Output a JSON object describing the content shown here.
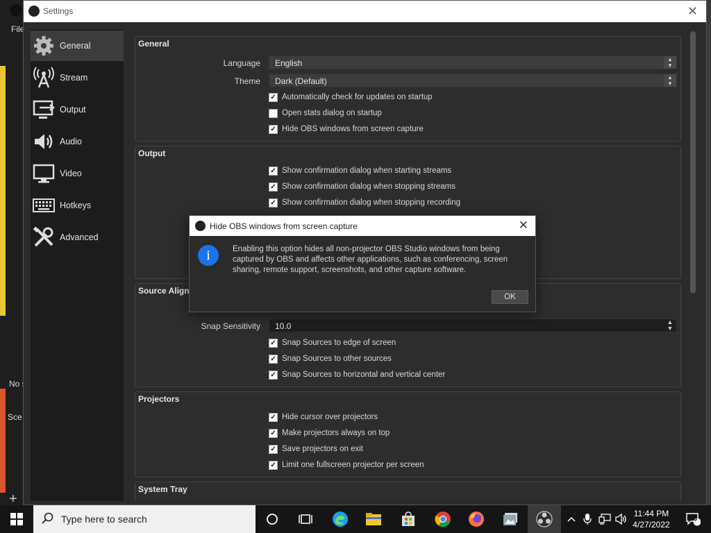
{
  "background": {
    "menu_file": "File",
    "no_source_text": "No s",
    "scenes_text": "Sce",
    "add_icon": "plus-icon"
  },
  "window": {
    "title": "Settings",
    "close": "✕"
  },
  "sidebar": {
    "items": [
      {
        "label": "General",
        "icon": "gear-icon"
      },
      {
        "label": "Stream",
        "icon": "broadcast-tower-icon"
      },
      {
        "label": "Output",
        "icon": "output-monitor-icon"
      },
      {
        "label": "Audio",
        "icon": "speaker-icon"
      },
      {
        "label": "Video",
        "icon": "monitor-icon"
      },
      {
        "label": "Hotkeys",
        "icon": "keyboard-icon"
      },
      {
        "label": "Advanced",
        "icon": "tools-icon"
      }
    ],
    "selected": "General"
  },
  "general": {
    "title": "General",
    "language_label": "Language",
    "language_value": "English",
    "theme_label": "Theme",
    "theme_value": "Dark (Default)",
    "checks": [
      {
        "label": "Automatically check for updates on startup",
        "checked": true
      },
      {
        "label": "Open stats dialog on startup",
        "checked": false
      },
      {
        "label": "Hide OBS windows from screen capture",
        "checked": true
      }
    ]
  },
  "output": {
    "title": "Output",
    "checks": [
      {
        "label": "Show confirmation dialog when starting streams",
        "checked": true
      },
      {
        "label": "Show confirmation dialog when stopping streams",
        "checked": true
      },
      {
        "label": "Show confirmation dialog when stopping recording",
        "checked": true
      }
    ]
  },
  "source_alignment": {
    "title": "Source Align",
    "snap_label": "Snap Sensitivity",
    "snap_value": "10.0",
    "checks": [
      {
        "label": "Snap Sources to edge of screen",
        "checked": true
      },
      {
        "label": "Snap Sources to other sources",
        "checked": true
      },
      {
        "label": "Snap Sources to horizontal and vertical center",
        "checked": true
      }
    ]
  },
  "projectors": {
    "title": "Projectors",
    "checks": [
      {
        "label": "Hide cursor over projectors",
        "checked": true
      },
      {
        "label": "Make projectors always on top",
        "checked": true
      },
      {
        "label": "Save projectors on exit",
        "checked": true
      },
      {
        "label": "Limit one fullscreen projector per screen",
        "checked": true
      }
    ]
  },
  "system_tray": {
    "title": "System Tray"
  },
  "dialog": {
    "title": "Hide OBS windows from screen capture",
    "icon": "info-icon",
    "icon_glyph": "i",
    "message": "Enabling this option hides all non-projector OBS Studio windows from being captured by OBS and affects other applications, such as conferencing, screen sharing, remote support, screenshots, and other capture software.",
    "ok_label": "OK"
  },
  "taskbar": {
    "search_placeholder": "Type here to search",
    "apps": [
      "task-view",
      "edge",
      "file-explorer",
      "store",
      "chrome",
      "firefox",
      "photos",
      "obs"
    ],
    "time": "11:44 PM",
    "date": "4/27/2022",
    "notification_count": "3",
    "colors": {
      "edge": "#1ba1e2",
      "chrome": "#db4437",
      "firefox": "#ff7139",
      "explorer": "#f4c430"
    }
  }
}
